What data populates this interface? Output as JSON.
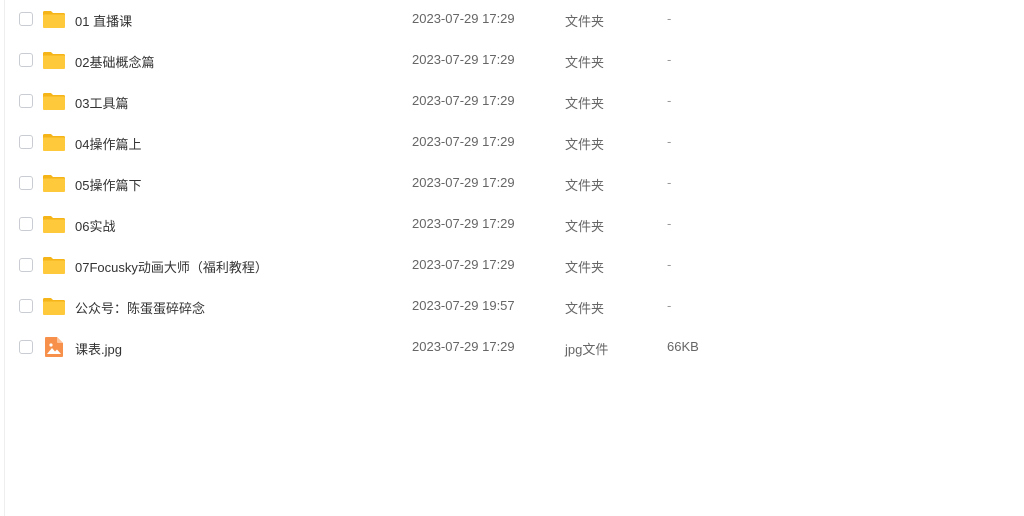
{
  "file_list": {
    "rows": [
      {
        "name": "01 直播课",
        "date": "2023-07-29 17:29",
        "type": "文件夹",
        "size": "-",
        "icon": "folder-icon"
      },
      {
        "name": "02基础概念篇",
        "date": "2023-07-29 17:29",
        "type": "文件夹",
        "size": "-",
        "icon": "folder-icon"
      },
      {
        "name": "03工具篇",
        "date": "2023-07-29 17:29",
        "type": "文件夹",
        "size": "-",
        "icon": "folder-icon"
      },
      {
        "name": "04操作篇上",
        "date": "2023-07-29 17:29",
        "type": "文件夹",
        "size": "-",
        "icon": "folder-icon"
      },
      {
        "name": "05操作篇下",
        "date": "2023-07-29 17:29",
        "type": "文件夹",
        "size": "-",
        "icon": "folder-icon"
      },
      {
        "name": "06实战",
        "date": "2023-07-29 17:29",
        "type": "文件夹",
        "size": "-",
        "icon": "folder-icon"
      },
      {
        "name": "07Focusky动画大师（福利教程）",
        "date": "2023-07-29 17:29",
        "type": "文件夹",
        "size": "-",
        "icon": "folder-icon"
      },
      {
        "name": "公众号：陈蛋蛋碎碎念",
        "date": "2023-07-29 19:57",
        "type": "文件夹",
        "size": "-",
        "icon": "folder-icon"
      },
      {
        "name": "课表.jpg",
        "date": "2023-07-29 17:29",
        "type": "jpg文件",
        "size": "66KB",
        "icon": "image-file-icon"
      }
    ]
  },
  "colors": {
    "folder": "#ffc93c",
    "folder_back": "#f5b417",
    "image_file": "#f7904a"
  }
}
